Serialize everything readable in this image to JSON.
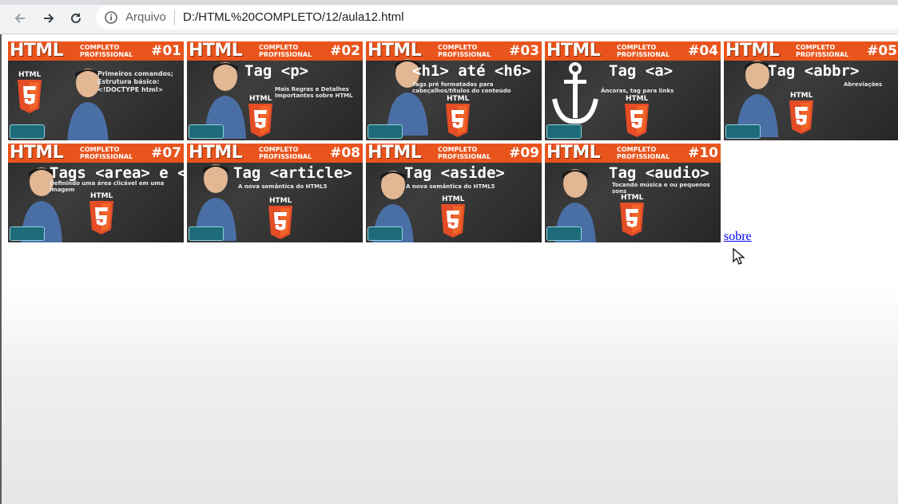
{
  "browser": {
    "scheme_label": "Arquivo",
    "url": "D:/HTML%20COMPLETO/12/aula12.html",
    "icons": [
      "back-arrow-icon",
      "forward-arrow-icon",
      "reload-icon",
      "info-icon"
    ]
  },
  "series": {
    "brand": "HTML",
    "line1": "COMPLETO",
    "line2": "PROFISSIONAL",
    "html_label": "HTML"
  },
  "thumbnails": [
    {
      "number": "#01",
      "title": "",
      "subtitle": "Primeiros comandos; Estrutura básico: <!DOCTYPE html>"
    },
    {
      "number": "#02",
      "title": "Tag <p>",
      "subtitle": "Mais Regras e Detalhes Importantes sobre HTML"
    },
    {
      "number": "#03",
      "title": "<h1> até <h6>",
      "subtitle": "Tags pré formatadas para cabeçalhos/títulos do conteúdo"
    },
    {
      "number": "#04",
      "title": "Tag <a>",
      "subtitle": "Âncoras, tag para links"
    },
    {
      "number": "#05",
      "title": "Tag <abbr>",
      "subtitle": "Abreviações"
    },
    {
      "number": "#07",
      "title": "Tags <area> e <map>",
      "subtitle": "Definindo uma área clicável em uma imagem"
    },
    {
      "number": "#08",
      "title": "Tag <article>",
      "subtitle": "A nova semântica do HTML5"
    },
    {
      "number": "#09",
      "title": "Tag <aside>",
      "subtitle": "A nova semântica do HTML5"
    },
    {
      "number": "#10",
      "title": "Tag <audio>",
      "subtitle": "Tocando música e ou pequenos sons"
    }
  ],
  "link": {
    "label": "sobre"
  },
  "colors": {
    "banner": "#e9541c",
    "link": "#0000ee",
    "html5_orange": "#e44d26"
  }
}
